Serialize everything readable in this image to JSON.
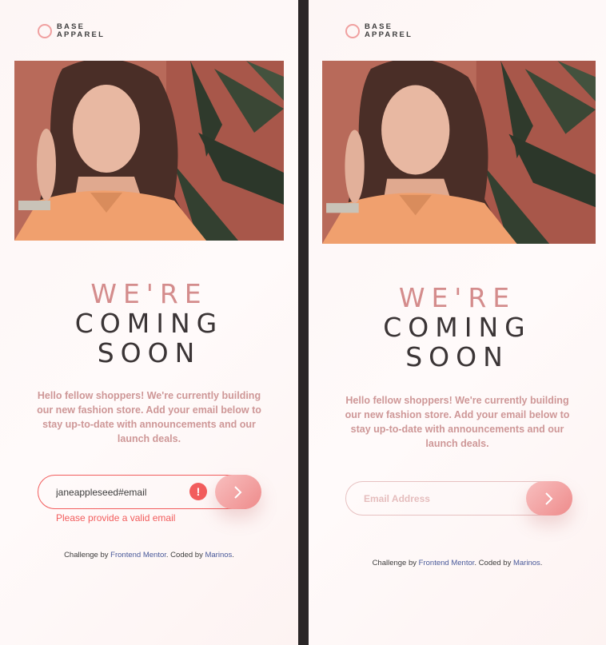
{
  "colors": {
    "accent": "#f25d5d",
    "rose": "#ce9797",
    "dark": "#3b3536"
  },
  "panels": [
    {
      "state": "error",
      "logo": {
        "line1": "BASE",
        "line2": "APPAREL"
      },
      "headline": {
        "line1": "WE'RE",
        "line2": "COMING",
        "line3": "SOON"
      },
      "description": "Hello fellow shoppers! We're currently building our new fashion store. Add your email below to stay up-to-date with announcements and our launch deals.",
      "email": {
        "value": "janeappleseed#email",
        "placeholder": "Email Address"
      },
      "error_icon": "!",
      "error_message": "Please provide a valid email",
      "attribution": {
        "prefix": "Challenge by",
        "link1": "Frontend Mentor",
        "middle": ". Coded by",
        "link2": "Marinos",
        "suffix": "."
      }
    },
    {
      "state": "default",
      "logo": {
        "line1": "BASE",
        "line2": "APPAREL"
      },
      "headline": {
        "line1": "WE'RE",
        "line2": "COMING",
        "line3": "SOON"
      },
      "description": "Hello fellow shoppers! We're currently building our new fashion store. Add your email below to stay up-to-date with announcements and our launch deals.",
      "email": {
        "value": "",
        "placeholder": "Email Address"
      },
      "attribution": {
        "prefix": "Challenge by",
        "link1": "Frontend Mentor",
        "middle": ". Coded by",
        "link2": "Marinos",
        "suffix": "."
      }
    }
  ]
}
